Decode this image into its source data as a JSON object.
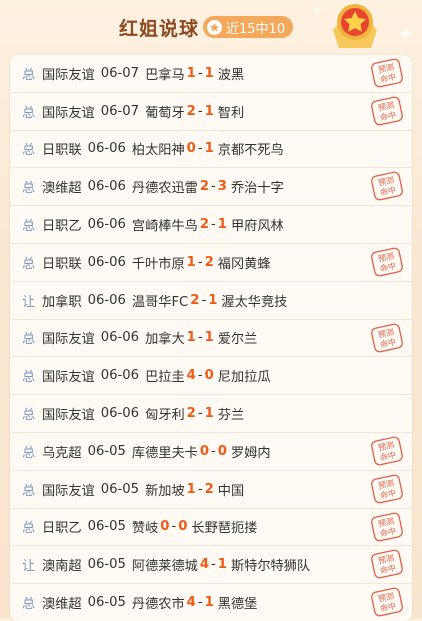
{
  "header": {
    "title": "红姐说球",
    "record": "近15中10"
  },
  "stamp_text": [
    "预测",
    "命中"
  ],
  "colors": {
    "accent": "#f05a14",
    "tag": "#7a9bc8",
    "stamp": "#e0604a",
    "title": "#8b4a1f"
  },
  "matches": [
    {
      "tag": "总",
      "league": "国际友谊",
      "date": "06-07",
      "home": "巴拿马",
      "hs": "1",
      "sep": "-",
      "as": "1",
      "away": "波黑",
      "hit": true
    },
    {
      "tag": "总",
      "league": "国际友谊",
      "date": "06-07",
      "home": "葡萄牙",
      "hs": "2",
      "sep": "-",
      "as": "1",
      "away": "智利",
      "hit": true
    },
    {
      "tag": "总",
      "league": "日职联",
      "date": "06-06",
      "home": "柏太阳神",
      "hs": "0",
      "sep": "-",
      "as": "1",
      "away": "京都不死鸟",
      "hit": false
    },
    {
      "tag": "总",
      "league": "澳维超",
      "date": "06-06",
      "home": "丹德农迅雷",
      "hs": "2",
      "sep": "-",
      "as": "3",
      "away": "乔治十字",
      "hit": true
    },
    {
      "tag": "总",
      "league": "日职乙",
      "date": "06-06",
      "home": "宫崎棒牛鸟",
      "hs": "2",
      "sep": "-",
      "as": "1",
      "away": "甲府风林",
      "hit": false
    },
    {
      "tag": "总",
      "league": "日职联",
      "date": "06-06",
      "home": "千叶市原",
      "hs": "1",
      "sep": "-",
      "as": "2",
      "away": "福冈黄蜂",
      "hit": true
    },
    {
      "tag": "让",
      "league": "加拿职",
      "date": "06-06",
      "home": "温哥华FC",
      "hs": "2",
      "sep": "-",
      "as": "1",
      "away": "渥太华竞技",
      "hit": false
    },
    {
      "tag": "总",
      "league": "国际友谊",
      "date": "06-06",
      "home": "加拿大",
      "hs": "1",
      "sep": "-",
      "as": "1",
      "away": "爱尔兰",
      "hit": true
    },
    {
      "tag": "总",
      "league": "国际友谊",
      "date": "06-06",
      "home": "巴拉圭",
      "hs": "4",
      "sep": "-",
      "as": "0",
      "away": "尼加拉瓜",
      "hit": false
    },
    {
      "tag": "总",
      "league": "国际友谊",
      "date": "06-06",
      "home": "匈牙利",
      "hs": "2",
      "sep": "-",
      "as": "1",
      "away": "芬兰",
      "hit": false
    },
    {
      "tag": "总",
      "league": "乌克超",
      "date": "06-05",
      "home": "库德里夫卡",
      "hs": "0",
      "sep": "-",
      "as": "0",
      "away": "罗姆内",
      "hit": true
    },
    {
      "tag": "总",
      "league": "国际友谊",
      "date": "06-05",
      "home": "新加坡",
      "hs": "1",
      "sep": "-",
      "as": "2",
      "away": "中国",
      "hit": true
    },
    {
      "tag": "总",
      "league": "日职乙",
      "date": "06-05",
      "home": "赞岐",
      "hs": "0",
      "sep": "-",
      "as": "0",
      "away": "长野琶扼搂",
      "hit": true
    },
    {
      "tag": "让",
      "league": "澳南超",
      "date": "06-05",
      "home": "阿德莱德城",
      "hs": "4",
      "sep": "-",
      "as": "1",
      "away": "斯特尔特狮队",
      "hit": true
    },
    {
      "tag": "总",
      "league": "澳维超",
      "date": "06-05",
      "home": "丹德农市",
      "hs": "4",
      "sep": "-",
      "as": "1",
      "away": "黑德堡",
      "hit": true
    }
  ]
}
